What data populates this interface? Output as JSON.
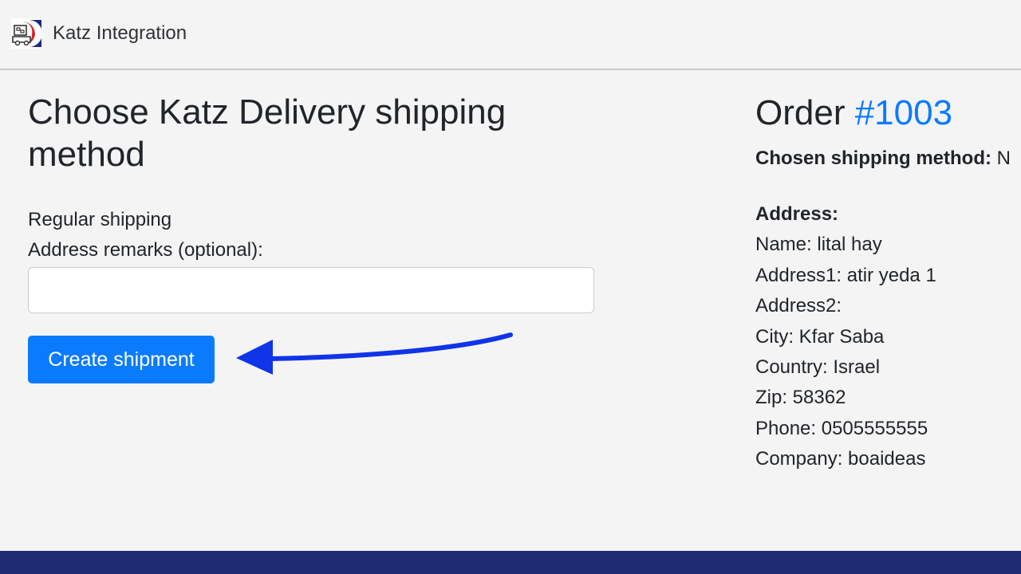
{
  "header": {
    "app_title": "Katz Integration",
    "logo_icon": "truck-logo-icon"
  },
  "main": {
    "title": "Choose Katz Delivery shipping method",
    "method": "Regular shipping",
    "remarks_label": "Address remarks (optional):",
    "remarks_value": "",
    "remarks_placeholder": "",
    "create_button_label": "Create shipment"
  },
  "order": {
    "heading_prefix": "Order ",
    "number": "#1003",
    "chosen_method_label": "Chosen shipping method:",
    "chosen_method_value": "N",
    "address_title": "Address:",
    "address_lines": [
      "Name: lital hay",
      "Address1: atir yeda 1",
      "Address2:",
      "City: Kfar Saba",
      "Country: Israel",
      "Zip: 58362",
      "Phone: 0505555555",
      "Company: boaideas"
    ]
  },
  "colors": {
    "accent": "#0a7bff",
    "arrow": "#1034e8",
    "footer": "#1f2c72",
    "background": "#f4f4f5"
  }
}
